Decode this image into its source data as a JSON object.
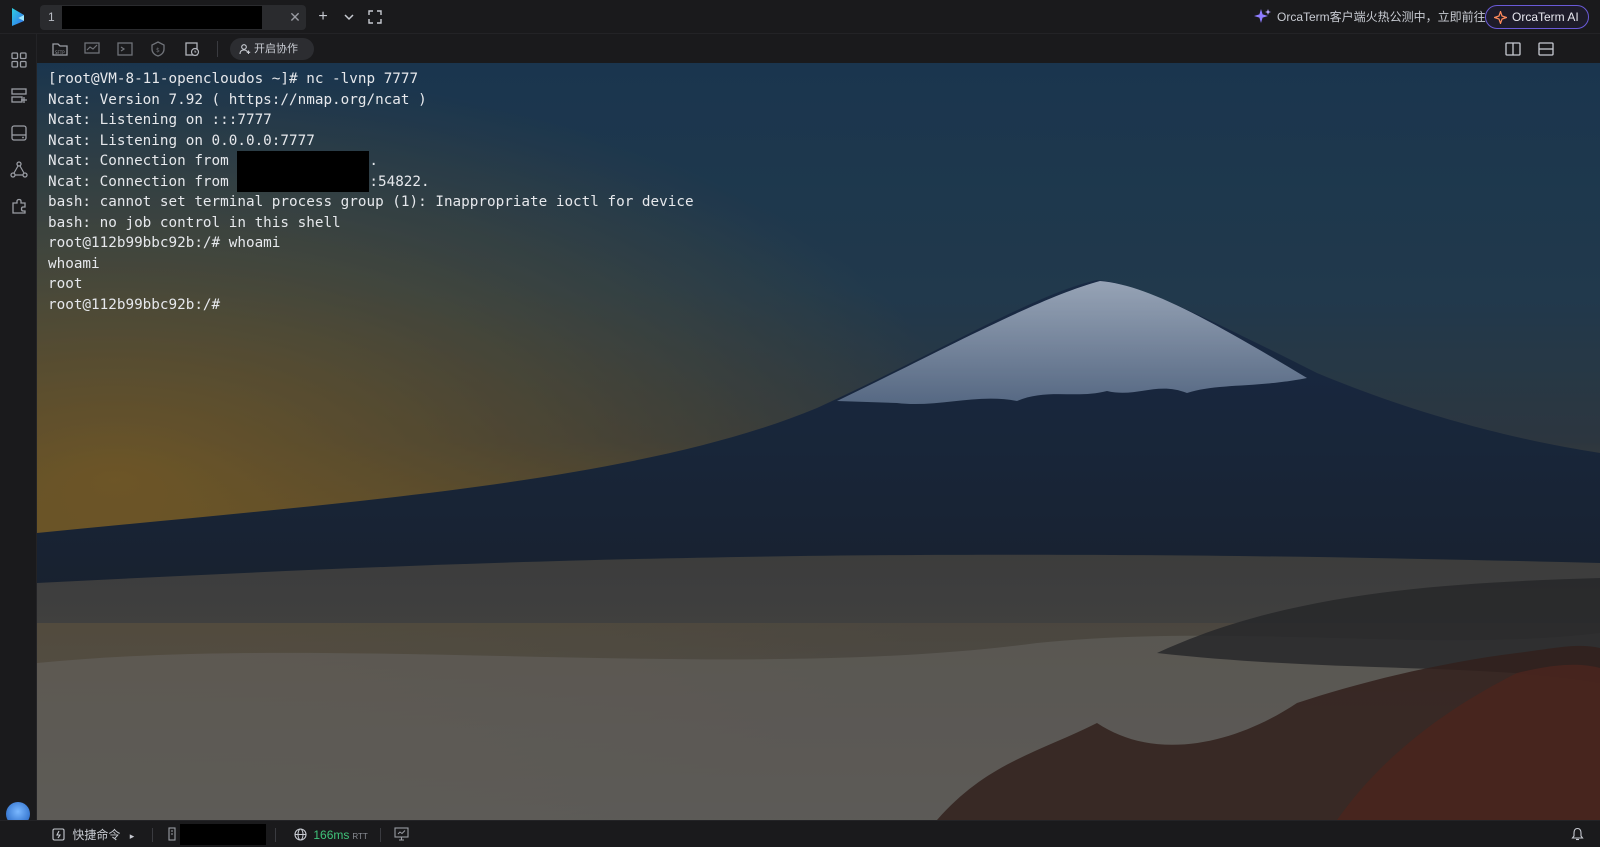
{
  "tabbar": {
    "tab_index": "1",
    "tab_title": "[redacted]",
    "close_glyph": "✕",
    "new_tab_glyph": "+",
    "dropdown_glyph": "⌄",
    "fullscreen_glyph": "⛶",
    "promo_text": "OrcaTerm客户端火热公测中，立即前往",
    "ai_button_label": "OrcaTerm AI"
  },
  "toolbar": {
    "collab_label": "开启协作"
  },
  "terminal": {
    "lines": [
      {
        "segments": [
          {
            "text": "[root@VM-8-11-opencloudos ~]# nc -lvnp 7777"
          }
        ]
      },
      {
        "segments": [
          {
            "text": "Ncat: Version 7.92 ( https://nmap.org/ncat )"
          }
        ]
      },
      {
        "segments": [
          {
            "text": "Ncat: Listening on :::7777"
          }
        ]
      },
      {
        "segments": [
          {
            "text": "Ncat: Listening on 0.0.0.0:7777"
          }
        ]
      },
      {
        "segments": [
          {
            "text": "Ncat: Connection from "
          },
          {
            "redacted": true
          },
          {
            "text": "."
          }
        ]
      },
      {
        "segments": [
          {
            "text": "Ncat: Connection from "
          },
          {
            "redacted": true
          },
          {
            "text": ":54822."
          }
        ]
      },
      {
        "segments": [
          {
            "text": "bash: cannot set terminal process group (1): Inappropriate ioctl for device"
          }
        ]
      },
      {
        "segments": [
          {
            "text": "bash: no job control in this shell"
          }
        ]
      },
      {
        "segments": [
          {
            "text": "root@112b99bbc92b:/# whoami"
          }
        ]
      },
      {
        "segments": [
          {
            "text": "whoami"
          }
        ]
      },
      {
        "segments": [
          {
            "text": "root"
          }
        ]
      },
      {
        "segments": [
          {
            "text": "root@112b99bbc92b:/#"
          }
        ]
      }
    ]
  },
  "statusbar": {
    "quick_cmd_label": "快捷命令",
    "quick_cmd_arrow": "▸",
    "host_name": "[redacted]",
    "latency": "166ms",
    "rtt_label": "RTT"
  },
  "icons": {
    "logo": "orcaterm-logo-icon",
    "sidebar": [
      "apps-icon",
      "server-list-icon",
      "drive-icon",
      "graph-icon",
      "plugin-icon"
    ],
    "toolbar": [
      "sftp-icon",
      "monitor-icon",
      "terminal-icon",
      "shield-icon",
      "snapshot-icon",
      "user-plus-icon"
    ],
    "right": [
      "split-vertical-icon",
      "split-horizontal-icon"
    ],
    "status": [
      "terminal-small-icon",
      "host-icon",
      "globe-icon",
      "screen-icon",
      "bell-icon"
    ]
  },
  "colors": {
    "accent": "#6a5ad8",
    "latency_good": "#3fc37a",
    "background": "#1a1a1c"
  }
}
